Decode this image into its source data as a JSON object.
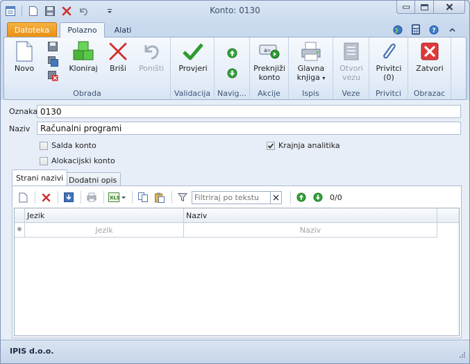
{
  "window": {
    "title": "Konto: 0130"
  },
  "tabs": {
    "file": "Datoteka",
    "home": "Polazno",
    "tools": "Alati"
  },
  "ribbon": {
    "obrada": {
      "label": "Obrada",
      "novo": "Novo",
      "kloniraj": "Kloniraj",
      "brisi": "Briši",
      "ponisti": "Poništi"
    },
    "validacija": {
      "label": "Validacija",
      "provjeri": "Provjeri"
    },
    "navigacija": {
      "label": "Navig..."
    },
    "akcije": {
      "label": "Akcije",
      "preknjizi_1": "Preknjiži",
      "preknjizi_2": "konto"
    },
    "ispis": {
      "label": "Ispis",
      "glavna_1": "Glavna",
      "glavna_2": "knjiga"
    },
    "veze": {
      "label": "Veze",
      "otvori_1": "Otvori",
      "otvori_2": "vezu"
    },
    "privitci": {
      "label": "Privitci",
      "privitci_1": "Privitci",
      "privitci_2": "(0)"
    },
    "obrazac": {
      "label": "Obrazac",
      "zatvori": "Zatvori"
    }
  },
  "form": {
    "oznaka_label": "Oznaka",
    "oznaka_value": "0130",
    "naziv_label": "Naziv",
    "naziv_value": "Računalni programi",
    "salda_konto": {
      "label": "Salda konto",
      "checked": false
    },
    "alokacijski_konto": {
      "label": "Alokacijski konto",
      "checked": false
    },
    "krajnja_analitika": {
      "label": "Krajnja analitika",
      "checked": true
    }
  },
  "inner_tabs": {
    "strani_nazivi": "Strani nazivi",
    "dodatni_opis": "Dodatni opis"
  },
  "grid_toolbar": {
    "filter_placeholder": "Filtriraj po tekstu",
    "counter": "0/0"
  },
  "grid": {
    "columns": [
      "Jezik",
      "Naziv"
    ],
    "new_row_placeholders": [
      "Jezik",
      "Naziv"
    ]
  },
  "status": {
    "company": "IPIS d.o.o."
  },
  "colors": {
    "accent_orange": "#e98f12",
    "green": "#2e9a2e",
    "red": "#d22b2b"
  }
}
